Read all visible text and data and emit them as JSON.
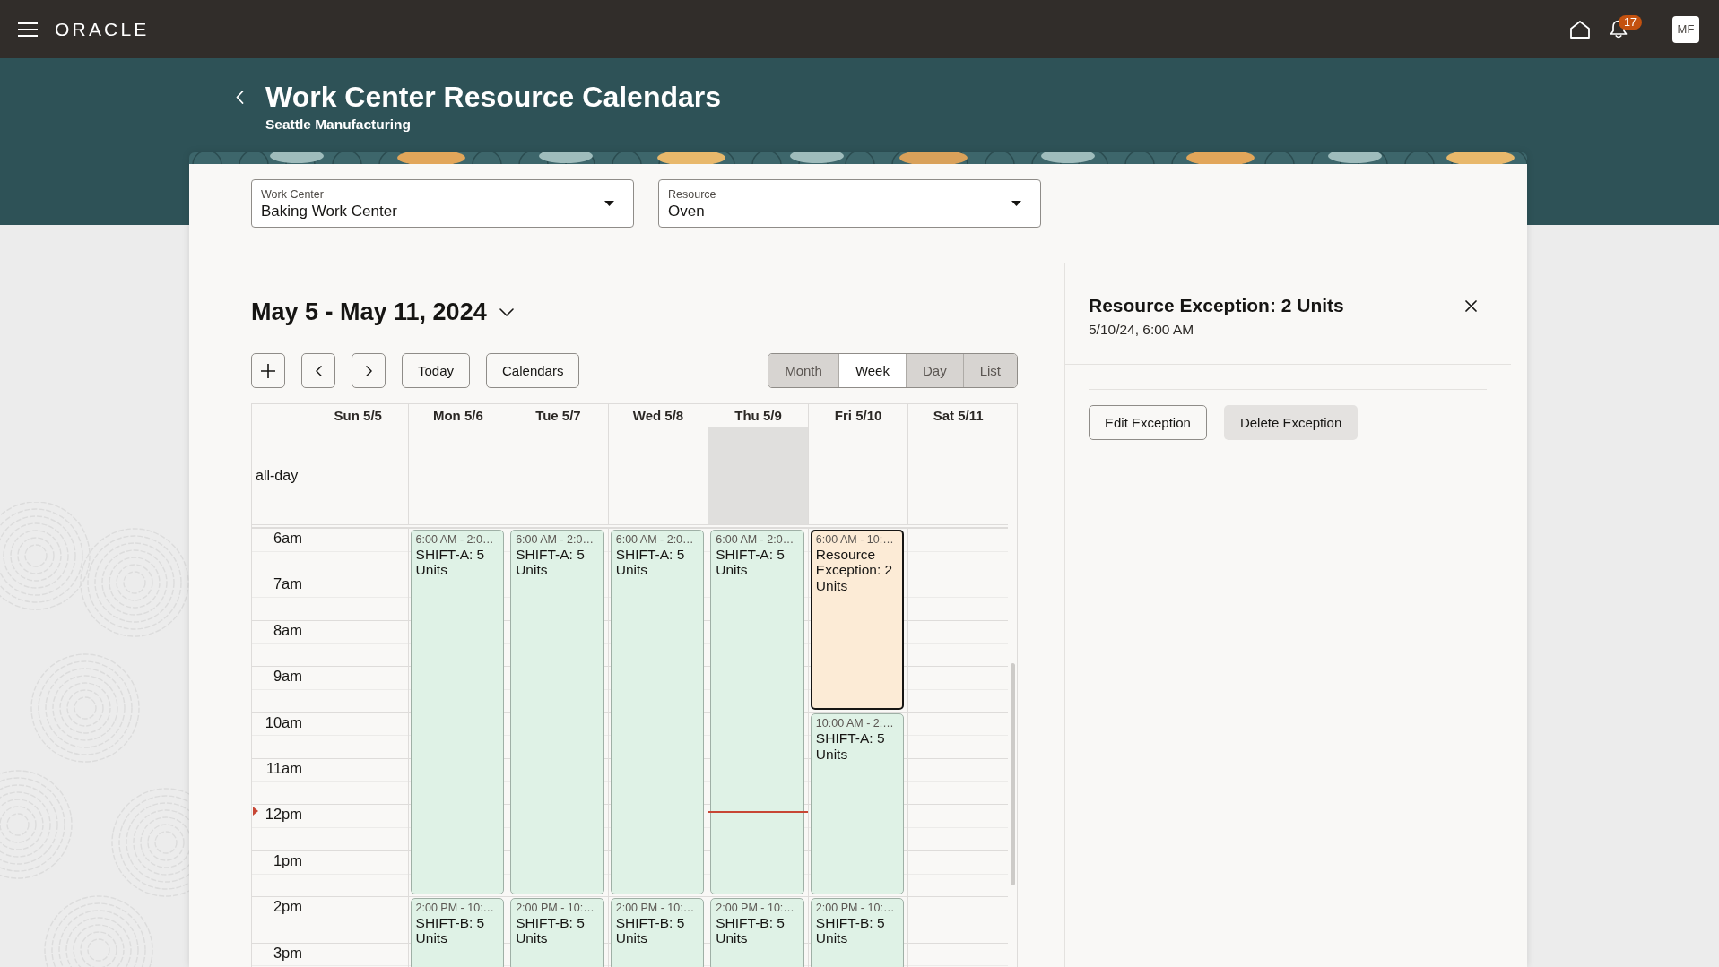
{
  "top_bar": {
    "logo": "ORACLE",
    "notification_count": "17",
    "avatar": "MF"
  },
  "header": {
    "title": "Work Center Resource Calendars",
    "subtitle": "Seattle Manufacturing"
  },
  "filters": [
    {
      "label": "Work Center",
      "value": "Baking Work Center"
    },
    {
      "label": "Resource",
      "value": "Oven"
    }
  ],
  "calendar": {
    "range": "May 5 - May 11, 2024",
    "toolbar": [
      "Today",
      "Calendars"
    ],
    "views": [
      {
        "label": "Month",
        "selected": false
      },
      {
        "label": "Week",
        "selected": true
      },
      {
        "label": "Day",
        "selected": false
      },
      {
        "label": "List",
        "selected": false
      }
    ],
    "all_day_label": "all-day",
    "hours": [
      {
        "label": "6am",
        "current": false
      },
      {
        "label": "7am",
        "current": false
      },
      {
        "label": "8am",
        "current": false
      },
      {
        "label": "9am",
        "current": false
      },
      {
        "label": "10am",
        "current": false
      },
      {
        "label": "11am",
        "current": false
      },
      {
        "label": "12pm",
        "current": true
      },
      {
        "label": "1pm",
        "current": false
      },
      {
        "label": "2pm",
        "current": false
      },
      {
        "label": "3pm",
        "current": false
      }
    ],
    "days": [
      {
        "label": "Sun 5/5",
        "today": false
      },
      {
        "label": "Mon 5/6",
        "today": false,
        "events": [
          {
            "time": "6:00 AM - 2:0…",
            "title": "SHIFT-A: 5 Units",
            "color": "#dff2e6",
            "selected": false
          },
          {
            "time": "2:00 PM - 10:…",
            "title": "SHIFT-B: 5 Units",
            "color": "#dff2e6",
            "selected": false
          }
        ]
      },
      {
        "label": "Tue 5/7",
        "today": false,
        "events": [
          {
            "time": "6:00 AM - 2:0…",
            "title": "SHIFT-A: 5 Units",
            "color": "#dff2e6",
            "selected": false
          },
          {
            "time": "2:00 PM - 10:…",
            "title": "SHIFT-B: 5 Units",
            "color": "#dff2e6",
            "selected": false
          }
        ]
      },
      {
        "label": "Wed 5/8",
        "today": false,
        "events": [
          {
            "time": "6:00 AM - 2:0…",
            "title": "SHIFT-A: 5 Units",
            "color": "#dff2e6",
            "selected": false
          },
          {
            "time": "2:00 PM - 10:…",
            "title": "SHIFT-B: 5 Units",
            "color": "#dff2e6",
            "selected": false
          }
        ]
      },
      {
        "label": "Thu 5/9",
        "today": true,
        "events": [
          {
            "time": "6:00 AM - 2:0…",
            "title": "SHIFT-A: 5 Units",
            "color": "#dff2e6",
            "selected": false
          },
          {
            "time": "2:00 PM - 10:…",
            "title": "SHIFT-B: 5 Units",
            "color": "#dff2e6",
            "selected": false
          }
        ]
      },
      {
        "label": "Fri 5/10",
        "today": false,
        "events": [
          {
            "time": "6:00 AM - 10:…",
            "title": "Resource Exception: 2 Units",
            "color": "#fcebd6",
            "selected": true
          },
          {
            "time": "10:00 AM - 2:…",
            "title": "SHIFT-A: 5 Units",
            "color": "#dff2e6",
            "selected": false
          },
          {
            "time": "2:00 PM - 10:…",
            "title": "SHIFT-B: 5 Units",
            "color": "#dff2e6",
            "selected": false
          }
        ]
      },
      {
        "label": "Sat 5/11",
        "today": false
      }
    ]
  },
  "detail_panel": {
    "title": "Resource Exception: 2 Units",
    "subtitle": "5/10/24, 6:00 AM",
    "actions": [
      {
        "label": "Edit Exception",
        "kind": "outlined"
      },
      {
        "label": "Delete Exception",
        "kind": "filled"
      }
    ]
  }
}
